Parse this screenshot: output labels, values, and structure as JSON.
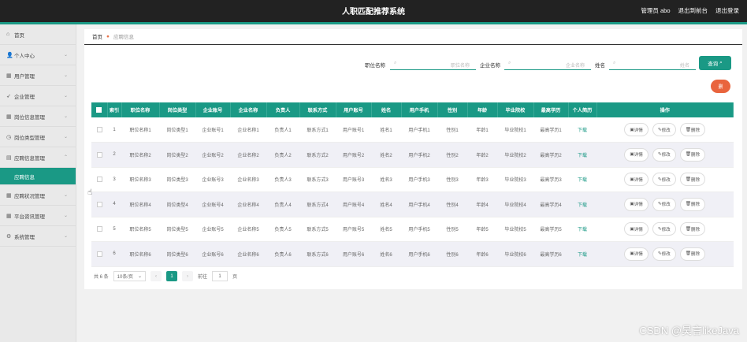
{
  "header": {
    "title": "人职匹配推荐系统",
    "user": "管理员 abo",
    "front": "退出到前台",
    "logout": "退出登录"
  },
  "sidebar": {
    "items": [
      {
        "label": "首页",
        "icon": "home-icon"
      },
      {
        "label": "个人中心",
        "icon": "user-icon"
      },
      {
        "label": "用户管理",
        "icon": "grid-icon"
      },
      {
        "label": "企业管理",
        "icon": "send-icon"
      },
      {
        "label": "岗位信息管理",
        "icon": "grid-icon"
      },
      {
        "label": "岗位类型管理",
        "icon": "clock-icon"
      },
      {
        "label": "应聘信息管理",
        "icon": "doc-icon"
      },
      {
        "label": "应聘信息",
        "icon": ""
      },
      {
        "label": "应聘状况管理",
        "icon": "grid-icon"
      },
      {
        "label": "平台资讯管理",
        "icon": "grid-icon"
      },
      {
        "label": "系统管理",
        "icon": "gear-icon"
      }
    ]
  },
  "breadcrumb": {
    "home": "首页",
    "current": "应聘信息"
  },
  "filters": [
    {
      "label": "职位名称",
      "placeholder": "职位名称"
    },
    {
      "label": "企业名称",
      "placeholder": "企业名称"
    },
    {
      "label": "姓名",
      "placeholder": "姓名"
    }
  ],
  "search_label": "查询",
  "delete_label": "删",
  "table": {
    "columns": [
      "索引",
      "职位名称",
      "岗位类型",
      "企业账号",
      "企业名称",
      "负责人",
      "联系方式",
      "用户账号",
      "姓名",
      "用户手机",
      "性别",
      "年龄",
      "毕业院校",
      "最高学历",
      "个人简历",
      "操作"
    ],
    "rows": [
      [
        "1",
        "职位名称1",
        "岗位类型1",
        "企业账号1",
        "企业名称1",
        "负责人1",
        "联系方式1",
        "用户账号1",
        "姓名1",
        "用户手机1",
        "性别1",
        "年龄1",
        "毕业院校1",
        "最高学历1",
        "下载"
      ],
      [
        "2",
        "职位名称2",
        "岗位类型2",
        "企业账号2",
        "企业名称2",
        "负责人2",
        "联系方式2",
        "用户账号2",
        "姓名2",
        "用户手机2",
        "性别2",
        "年龄2",
        "毕业院校2",
        "最高学历2",
        "下载"
      ],
      [
        "3",
        "职位名称3",
        "岗位类型3",
        "企业账号3",
        "企业名称3",
        "负责人3",
        "联系方式3",
        "用户账号3",
        "姓名3",
        "用户手机3",
        "性别3",
        "年龄3",
        "毕业院校3",
        "最高学历3",
        "下载"
      ],
      [
        "4",
        "职位名称4",
        "岗位类型4",
        "企业账号4",
        "企业名称4",
        "负责人4",
        "联系方式4",
        "用户账号4",
        "姓名4",
        "用户手机4",
        "性别4",
        "年龄4",
        "毕业院校4",
        "最高学历4",
        "下载"
      ],
      [
        "5",
        "职位名称5",
        "岗位类型5",
        "企业账号5",
        "企业名称5",
        "负责人5",
        "联系方式5",
        "用户账号5",
        "姓名5",
        "用户手机5",
        "性别5",
        "年龄5",
        "毕业院校5",
        "最高学历5",
        "下载"
      ],
      [
        "6",
        "职位名称6",
        "岗位类型6",
        "企业账号6",
        "企业名称6",
        "负责人6",
        "联系方式6",
        "用户账号6",
        "姓名6",
        "用户手机6",
        "性别6",
        "年龄6",
        "毕业院校6",
        "最高学历6",
        "下载"
      ]
    ],
    "actions": [
      "详情",
      "修改",
      "删除"
    ]
  },
  "pager": {
    "total": "共 6 条",
    "per_page": "10条/页",
    "page": "1",
    "goto_label": "前往",
    "goto_value": "1",
    "page_unit": "页"
  },
  "watermark": "CSDN @昊言likeJava",
  "colors": {
    "accent": "#1a9985",
    "danger": "#e9643d"
  }
}
